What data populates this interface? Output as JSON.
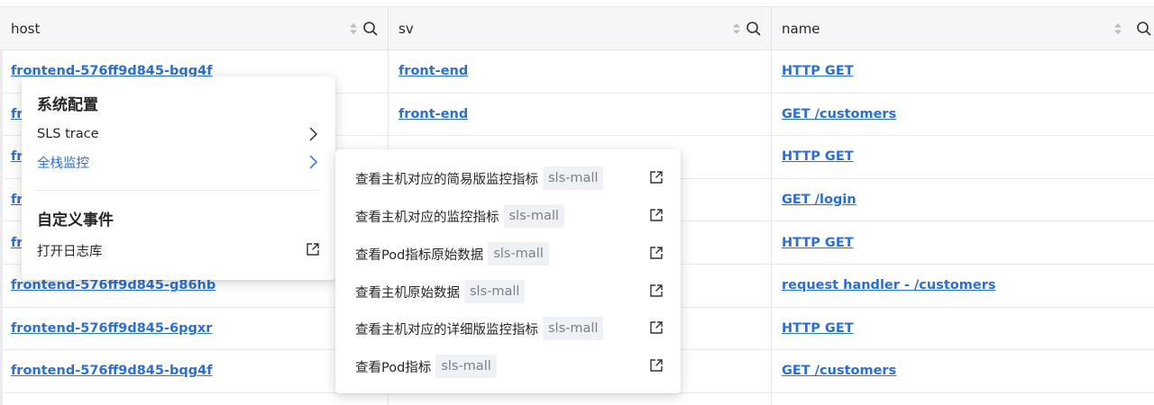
{
  "table": {
    "columns": [
      {
        "label": "host"
      },
      {
        "label": "sv"
      },
      {
        "label": "name"
      }
    ],
    "rows": [
      {
        "host": "frontend-576ff9d845-bqg4f",
        "sv": "front-end",
        "name": "HTTP GET"
      },
      {
        "host": "fr",
        "sv": "front-end",
        "name": "GET /customers"
      },
      {
        "host": "fr",
        "sv": "",
        "name": "HTTP GET"
      },
      {
        "host": "fr",
        "sv": "",
        "name": "GET /login"
      },
      {
        "host": "fr",
        "sv": "",
        "name": "HTTP GET"
      },
      {
        "host": "frontend-576ff9d845-g86hb",
        "sv": "",
        "name": "request handler - /customers"
      },
      {
        "host": "frontend-576ff9d845-6pgxr",
        "sv": "",
        "name": "HTTP GET"
      },
      {
        "host": "frontend-576ff9d845-bqg4f",
        "sv": "",
        "name": "GET /customers"
      }
    ]
  },
  "context_menu": {
    "group1_title": "系统配置",
    "items": [
      {
        "label": "SLS trace"
      },
      {
        "label": "全栈监控"
      }
    ],
    "group2_title": "自定义事件",
    "open_logstore_label": "打开日志库"
  },
  "submenu": {
    "items": [
      {
        "label": "查看主机对应的简易版监控指标",
        "tag": "sls-mall"
      },
      {
        "label": "查看主机对应的监控指标",
        "tag": "sls-mall"
      },
      {
        "label": "查看Pod指标原始数据",
        "tag": "sls-mall"
      },
      {
        "label": "查看主机原始数据",
        "tag": "sls-mall"
      },
      {
        "label": "查看主机对应的详细版监控指标",
        "tag": "sls-mall"
      },
      {
        "label": "查看Pod指标",
        "tag": "sls-mall"
      }
    ]
  },
  "colors": {
    "link": "#2a6fd6",
    "header_bg": "#f6f7f9",
    "tag_bg": "#eef1f5",
    "active": "#2a6fd6"
  },
  "icons": [
    "sort-icon",
    "search-icon",
    "chevron-right-icon",
    "external-link-icon"
  ]
}
